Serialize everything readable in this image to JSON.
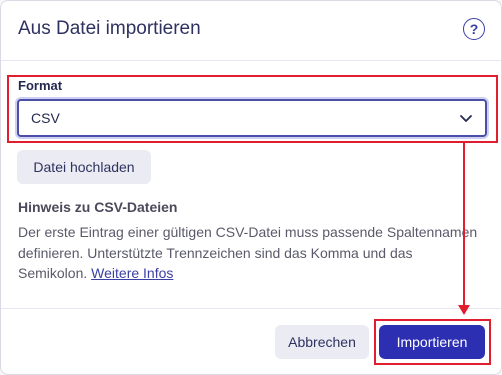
{
  "dialog": {
    "title": "Aus Datei importieren",
    "help_icon": "help-circle-icon",
    "help_glyph": "?"
  },
  "format": {
    "label": "Format",
    "selected": "CSV",
    "chevron_icon": "chevron-down-icon"
  },
  "upload": {
    "label": "Datei hochladen"
  },
  "hint": {
    "title": "Hinweis zu CSV-Dateien",
    "text": "Der erste Eintrag einer gültigen CSV-Datei muss passende Spaltennamen definieren. Unterstützte Trennzeichen sind das Komma und das Semikolon. ",
    "link_label": "Weitere Infos"
  },
  "footer": {
    "cancel_label": "Abbrechen",
    "import_label": "Importieren"
  },
  "colors": {
    "accent": "#2d2fb3",
    "annotation": "#e01e2f"
  }
}
